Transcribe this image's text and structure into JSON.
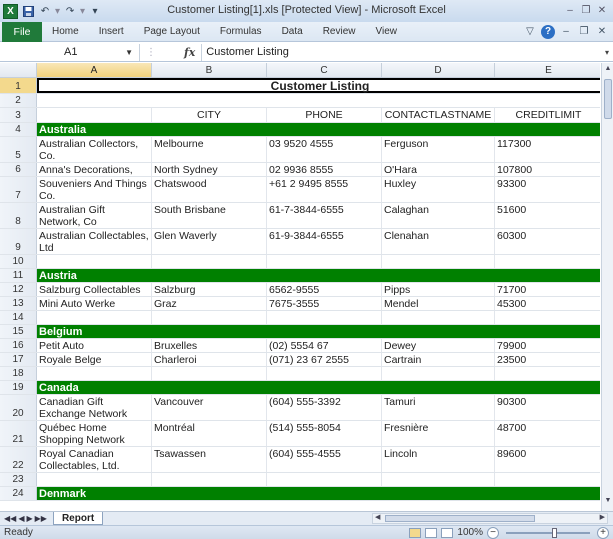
{
  "window": {
    "title": "Customer Listing[1].xls  [Protected View]  -  Microsoft Excel",
    "app_icon": "X",
    "qat": [
      "save-icon",
      "undo-icon",
      "redo-icon",
      "customize-icon"
    ]
  },
  "ribbon": {
    "file": "File",
    "tabs": [
      "Home",
      "Insert",
      "Page Layout",
      "Formulas",
      "Data",
      "Review",
      "View"
    ]
  },
  "formula_bar": {
    "name_box": "A1",
    "fx": "fx",
    "content": "Customer Listing"
  },
  "columns": [
    "A",
    "B",
    "C",
    "D",
    "E"
  ],
  "sheet": {
    "title": "Customer Listing",
    "headers": {
      "b": "CITY",
      "c": "PHONE",
      "d": "CONTACTLASTNAME",
      "e": "CREDITLIMIT"
    },
    "rows": [
      {
        "n": "4",
        "type": "country",
        "a": "Australia"
      },
      {
        "n": "5",
        "a": "Australian Collectors, Co.",
        "b": "Melbourne",
        "c": "03 9520 4555",
        "d": "Ferguson",
        "e": "117300"
      },
      {
        "n": "6",
        "a": "Anna's Decorations, Ltd",
        "b": "North Sydney",
        "c": "02 9936 8555",
        "d": "O'Hara",
        "e": "107800"
      },
      {
        "n": "7",
        "a": "Souveniers And Things Co.",
        "b": "Chatswood",
        "c": "+61 2 9495 8555",
        "d": "Huxley",
        "e": "93300"
      },
      {
        "n": "8",
        "a": "Australian Gift Network, Co",
        "b": "South Brisbane",
        "c": "61-7-3844-6555",
        "d": "Calaghan",
        "e": "51600"
      },
      {
        "n": "9",
        "a": "Australian Collectables, Ltd",
        "b": "Glen Waverly",
        "c": "61-9-3844-6555",
        "d": "Clenahan",
        "e": "60300"
      },
      {
        "n": "10",
        "type": "blank"
      },
      {
        "n": "11",
        "type": "country",
        "a": "Austria"
      },
      {
        "n": "12",
        "a": "Salzburg Collectables",
        "b": "Salzburg",
        "c": "6562-9555",
        "d": "Pipps",
        "e": "71700"
      },
      {
        "n": "13",
        "a": "Mini Auto Werke",
        "b": "Graz",
        "c": "7675-3555",
        "d": "Mendel",
        "e": "45300"
      },
      {
        "n": "14",
        "type": "blank"
      },
      {
        "n": "15",
        "type": "country",
        "a": "Belgium"
      },
      {
        "n": "16",
        "a": "Petit Auto",
        "b": "Bruxelles",
        "c": "(02) 5554 67",
        "d": "Dewey",
        "e": "79900"
      },
      {
        "n": "17",
        "a": "Royale Belge",
        "b": "Charleroi",
        "c": "(071) 23 67 2555",
        "d": "Cartrain",
        "e": "23500"
      },
      {
        "n": "18",
        "type": "blank"
      },
      {
        "n": "19",
        "type": "country",
        "a": "Canada"
      },
      {
        "n": "20",
        "a": "Canadian Gift Exchange Network",
        "b": "Vancouver",
        "c": "(604) 555-3392",
        "d": "Tamuri",
        "e": "90300"
      },
      {
        "n": "21",
        "a": "Québec Home Shopping Network",
        "b": "Montréal",
        "c": "(514) 555-8054",
        "d": "Fresnière",
        "e": "48700"
      },
      {
        "n": "22",
        "a": "Royal Canadian Collectables, Ltd.",
        "b": "Tsawassen",
        "c": "(604) 555-4555",
        "d": "Lincoln",
        "e": "89600"
      },
      {
        "n": "23",
        "type": "blank"
      },
      {
        "n": "24",
        "type": "country",
        "a": "Denmark"
      }
    ]
  },
  "sheet_tab": "Report",
  "status": {
    "ready": "Ready",
    "zoom": "100%"
  }
}
